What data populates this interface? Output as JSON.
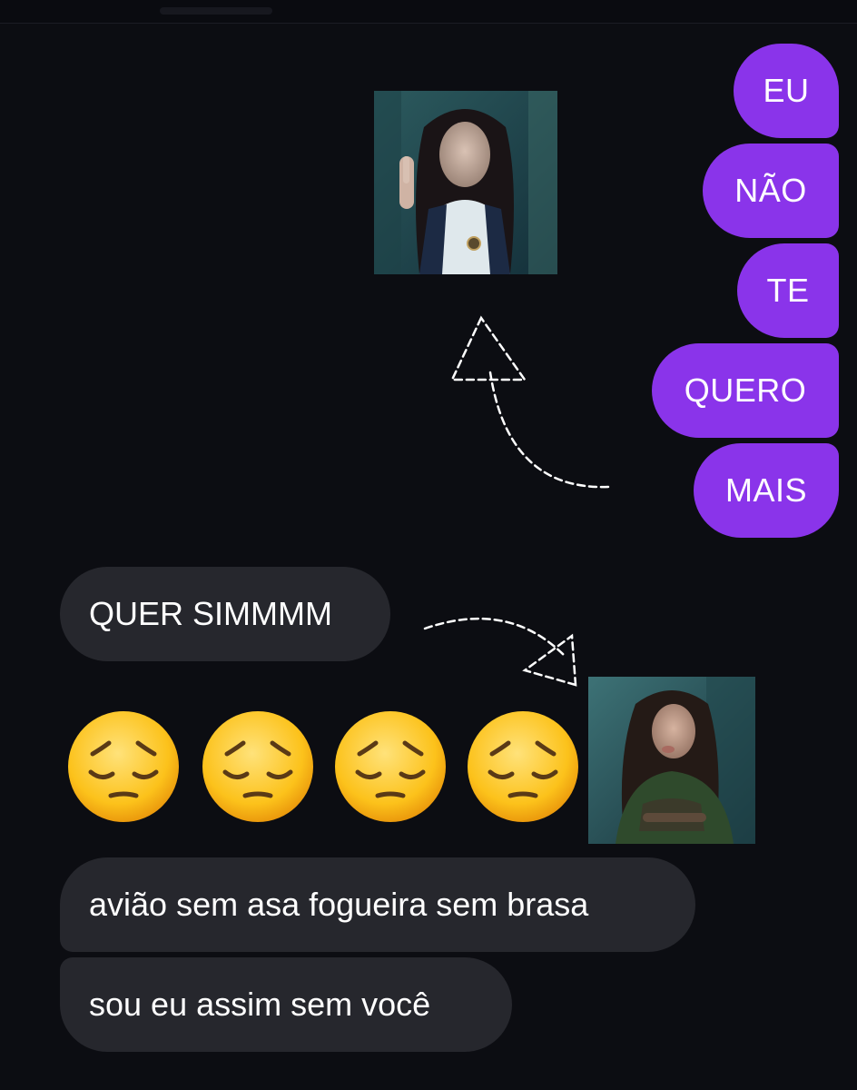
{
  "messages_out": [
    {
      "text": "EU"
    },
    {
      "text": "NÃO"
    },
    {
      "text": "TE"
    },
    {
      "text": "QUERO"
    },
    {
      "text": "MAIS"
    }
  ],
  "messages_in": [
    {
      "text": "QUER SIMMMM"
    },
    {
      "text": "avião sem asa fogueira sem brasa"
    },
    {
      "text": "sou eu assim sem você"
    }
  ],
  "emoji": {
    "icon": "pensive-face-icon",
    "count": 4
  },
  "colors": {
    "background": "#0c0d12",
    "outgoing_bubble": "#8a34ea",
    "incoming_bubble": "#26272d",
    "text": "#ffffff"
  }
}
